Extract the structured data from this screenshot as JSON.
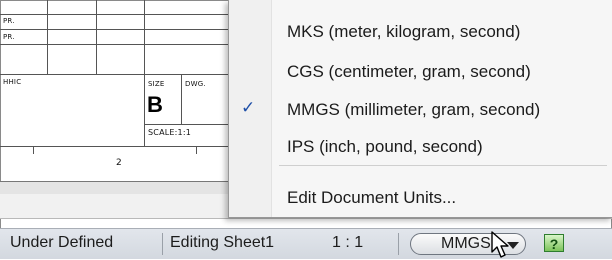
{
  "drawing": {
    "small_labels": [
      "PR.",
      "PR.",
      "HHIC"
    ],
    "size_label": "SIZE",
    "size_value": "B",
    "dwg_label": "DWG.",
    "scale_label": "SCALE:1:1",
    "zone_number": "2"
  },
  "units_menu": {
    "items": [
      {
        "label": "MKS (meter, kilogram, second)",
        "checked": false
      },
      {
        "label": "CGS (centimeter, gram, second)",
        "checked": false
      },
      {
        "label": "MMGS (millimeter, gram, second)",
        "checked": true
      },
      {
        "label": "IPS (inch, pound, second)",
        "checked": false
      }
    ],
    "edit_label": "Edit Document Units...",
    "check_glyph": "✓"
  },
  "status_bar": {
    "state": "Under Defined",
    "mode": "Editing Sheet1",
    "scale": "1 : 1",
    "units_button": "MMGS",
    "help_glyph": "?"
  },
  "colors": {
    "check": "#1e4fa8",
    "help_green": "#7cc35a"
  }
}
